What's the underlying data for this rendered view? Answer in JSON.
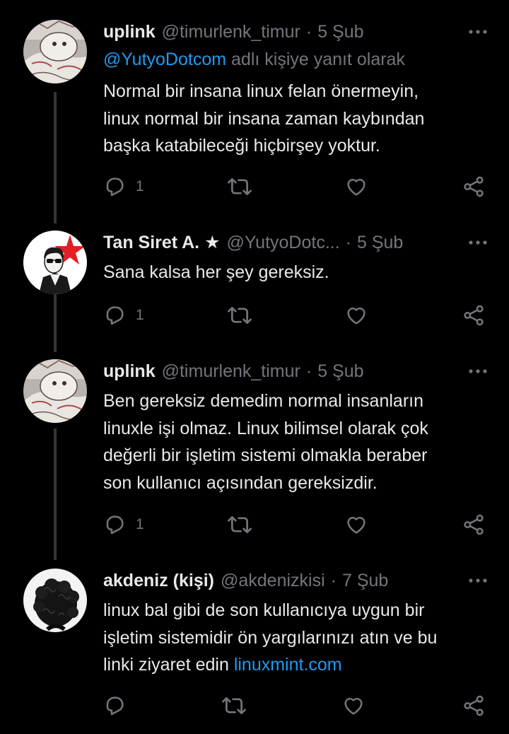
{
  "tweets": [
    {
      "name": "uplink",
      "handle": "@timurlenk_timur",
      "date": "5 Şub",
      "replying": {
        "user": "@YutyoDotcom",
        "suffix": "adlı kişiye yanıt olarak"
      },
      "lines": [
        "Normal bir insana linux felan önermeyin,",
        "linux normal bir insana zaman kaybından",
        "başka katabileceği hiçbirşey yoktur."
      ],
      "reply_count": "1",
      "avatar": "cartoon-avatar"
    },
    {
      "name": "Tan Siret A. ★",
      "handle": "@YutyoDotc...",
      "date": "5 Şub",
      "lines": [
        "Sana kalsa her şey gereksiz."
      ],
      "reply_count": "1",
      "avatar": "sunglasses-man-red-star-avatar"
    },
    {
      "name": "uplink",
      "handle": "@timurlenk_timur",
      "date": "5 Şub",
      "lines": [
        "Ben gereksiz demedim normal insanların",
        "linuxle işi olmaz. Linux bilimsel olarak çok",
        "değerli bir işletim sistemi olmakla beraber",
        "son kullanıcı açısından gereksizdir."
      ],
      "reply_count": "1",
      "avatar": "cartoon-avatar"
    },
    {
      "name": "akdeniz (kişi)",
      "handle": "@akdenizkisi",
      "date": "7 Şub",
      "lines": [
        "linux bal gibi de son kullanıcıya uygun bir",
        "işletim sistemidir ön yargılarınızı atın ve bu"
      ],
      "last_line_text": "linki ziyaret edin ",
      "last_line_link": "linuxmint.com",
      "reply_count": "",
      "avatar": "curly-hair-avatar"
    }
  ],
  "separator": "·",
  "icons": [
    "reply-icon",
    "retweet-icon",
    "like-icon",
    "share-icon",
    "more-icon"
  ],
  "colors": {
    "background": "#000000",
    "text": "#e7e9ea",
    "muted": "#71767b",
    "link": "#1d9bf0",
    "thread": "#333639"
  }
}
